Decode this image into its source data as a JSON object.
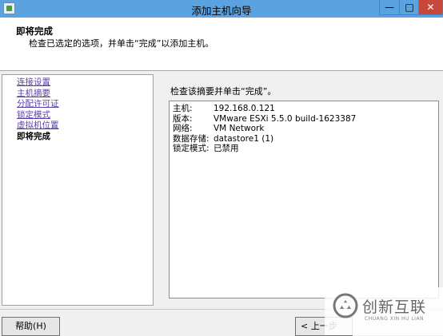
{
  "window": {
    "title": "添加主机向导",
    "icon": "vsphere-app-icon",
    "controls": {
      "minimize": "—",
      "maximize": "□",
      "close": "✕"
    }
  },
  "header": {
    "title": "即将完成",
    "description": "检查已选定的选项，并单击“完成”以添加主机。"
  },
  "nav": {
    "items": [
      {
        "label": "连接设置",
        "link": true
      },
      {
        "label": "主机摘要",
        "link": true
      },
      {
        "label": "分配许可证",
        "link": true
      },
      {
        "label": "锁定模式",
        "link": true
      },
      {
        "label": "虚拟机位置",
        "link": true
      },
      {
        "label": "即将完成",
        "link": false,
        "current": true
      }
    ]
  },
  "main": {
    "instruction": "检查该摘要并单击“完成”。",
    "summary": [
      {
        "key": "主机:",
        "value": "192.168.0.121"
      },
      {
        "key": "版本:",
        "value": "VMware ESXi 5.5.0 build-1623387"
      },
      {
        "key": "网络:",
        "value": "VM Network"
      },
      {
        "key": "数据存储:",
        "value": "datastore1 (1)"
      },
      {
        "key": "锁定模式:",
        "value": "已禁用"
      }
    ]
  },
  "footer": {
    "help_label": "帮助(H)",
    "back_label": "< 上一步"
  },
  "watermark": {
    "text": "创新互联",
    "sub": "CHUANG XIN HU LIAN"
  },
  "colors": {
    "titlebar": "#5aa2e0",
    "close_button": "#c7473a",
    "link": "#5a3ea8",
    "panel_bg": "#f0f0f0"
  }
}
